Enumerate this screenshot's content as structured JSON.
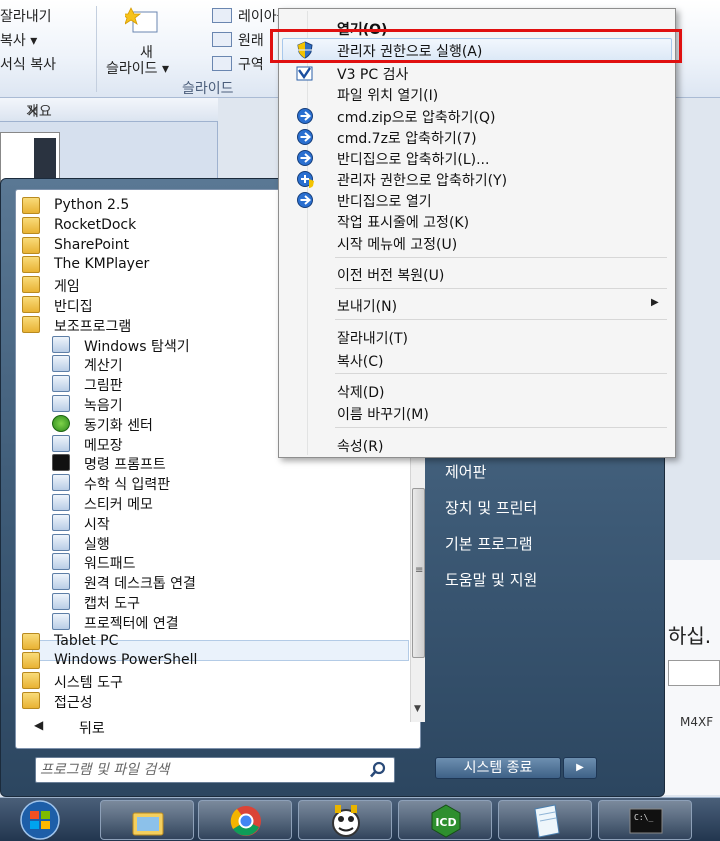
{
  "ribbon": {
    "cut": "잘라내기",
    "copy": "복사 ▾",
    "format_copy": "서식 복사",
    "new_slide_line1": "새",
    "new_slide_line2": "슬라이드 ▾",
    "layout": "레이아웃",
    "reset": "원래",
    "section": "구역",
    "group_label": "슬라이드"
  },
  "outline_pane": {
    "tab_label": "개요",
    "close": "×"
  },
  "context_menu": {
    "items": [
      {
        "label": "열기(O)",
        "icon": "none"
      },
      {
        "label": "관리자 권한으로 실행(A)",
        "icon": "uac-shield-icon"
      },
      {
        "label": "V3 PC 검사",
        "icon": "v3-icon"
      },
      {
        "label": "파일 위치 열기(I)",
        "icon": "none"
      },
      {
        "label": "cmd.zip으로 압축하기(Q)",
        "icon": "bandizip-icon"
      },
      {
        "label": "cmd.7z로 압축하기(7)",
        "icon": "bandizip-icon"
      },
      {
        "label": "반디집으로 압축하기(L)...",
        "icon": "bandizip-icon"
      },
      {
        "label": "관리자 권한으로 압축하기(Y)",
        "icon": "bandizip-shield-icon"
      },
      {
        "label": "반디집으로 열기",
        "icon": "bandizip-icon"
      },
      {
        "label": "작업 표시줄에 고정(K)",
        "icon": "none"
      },
      {
        "label": "시작 메뉴에 고정(U)",
        "icon": "none"
      },
      {
        "label": "이전 버전 복원(U)",
        "icon": "none"
      },
      {
        "label": "보내기(N)",
        "icon": "none"
      },
      {
        "label": "잘라내기(T)",
        "icon": "none"
      },
      {
        "label": "복사(C)",
        "icon": "none"
      },
      {
        "label": "삭제(D)",
        "icon": "none"
      },
      {
        "label": "이름 바꾸기(M)",
        "icon": "none"
      },
      {
        "label": "속성(R)",
        "icon": "none"
      }
    ],
    "submenu_arrow": "▶",
    "highlighted_item": "관리자 권한으로 실행(A)"
  },
  "start_menu": {
    "programs": [
      {
        "label": "Python 2.5",
        "icon": "folder-icon"
      },
      {
        "label": "RocketDock",
        "icon": "folder-icon"
      },
      {
        "label": "SharePoint",
        "icon": "folder-icon"
      },
      {
        "label": "The KMPlayer",
        "icon": "folder-icon"
      },
      {
        "label": "게임",
        "icon": "folder-icon"
      },
      {
        "label": "반디집",
        "icon": "folder-icon"
      },
      {
        "label": "보조프로그램",
        "icon": "folder-icon"
      },
      {
        "label": "Windows 탐색기",
        "icon": "explorer-icon"
      },
      {
        "label": "계산기",
        "icon": "calculator-icon"
      },
      {
        "label": "그림판",
        "icon": "paint-icon"
      },
      {
        "label": "녹음기",
        "icon": "microphone-icon"
      },
      {
        "label": "동기화 센터",
        "icon": "sync-center-icon"
      },
      {
        "label": "메모장",
        "icon": "notepad-icon"
      },
      {
        "label": "명령 프롬프트",
        "icon": "cmd-icon"
      },
      {
        "label": "수학 식 입력판",
        "icon": "math-input-icon"
      },
      {
        "label": "스티커 메모",
        "icon": "sticky-notes-icon"
      },
      {
        "label": "시작",
        "icon": "getting-started-icon"
      },
      {
        "label": "실행",
        "icon": "run-icon"
      },
      {
        "label": "워드패드",
        "icon": "wordpad-icon"
      },
      {
        "label": "원격 데스크톱 연결",
        "icon": "remote-desktop-icon"
      },
      {
        "label": "캡처 도구",
        "icon": "snipping-tool-icon"
      },
      {
        "label": "프로젝터에 연결",
        "icon": "projector-icon"
      },
      {
        "label": "Tablet PC",
        "icon": "folder-icon"
      },
      {
        "label": "Windows PowerShell",
        "icon": "folder-icon"
      },
      {
        "label": "시스템 도구",
        "icon": "folder-icon"
      },
      {
        "label": "접근성",
        "icon": "folder-icon"
      }
    ],
    "selected_program": "명령 프롬프트",
    "back_label": "뒤로",
    "back_arrow": "◀",
    "search_placeholder": "프로그램 및 파일 검색",
    "right_items": [
      "제어판",
      "장치 및 프린터",
      "기본 프로그램",
      "도움말 및 지원"
    ],
    "shutdown_label": "시스템 종료",
    "shutdown_arrow": "▶"
  },
  "background_dialog": {
    "text1": "하십.",
    "text2": "M4XF"
  },
  "taskbar": {
    "buttons": [
      "explorer-icon",
      "chrome-icon",
      "kmplayer-icon",
      "bandizip-taskbar-icon",
      "notepad-taskbar-icon",
      "cmd-taskbar-icon"
    ]
  },
  "colors": {
    "highlight_border": "#e01010",
    "menu_hover": "#dce9f7",
    "start_menu_bg": "#3d5a76"
  }
}
